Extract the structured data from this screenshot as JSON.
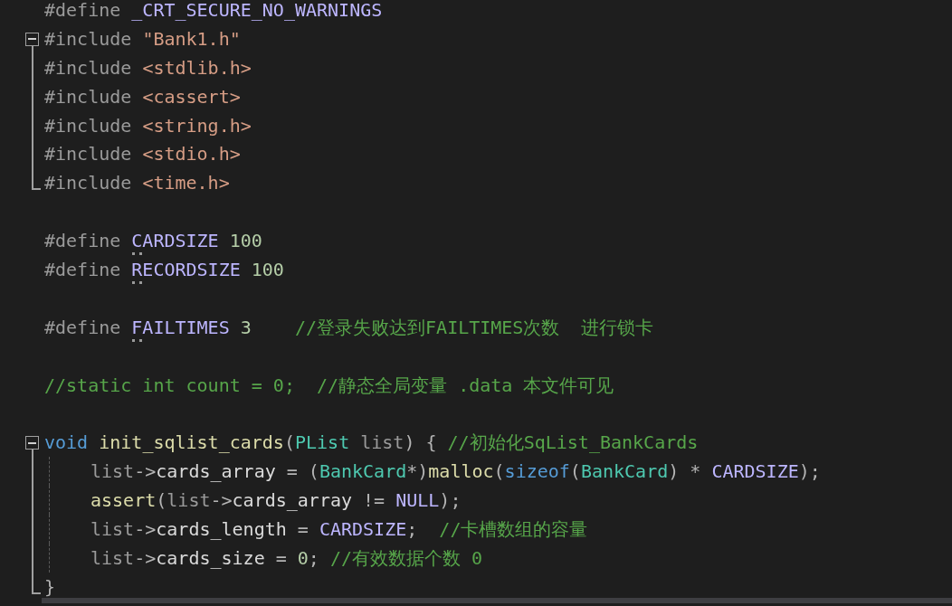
{
  "editor": {
    "lines": [
      {
        "kind": "code",
        "fold_box": false,
        "fold_line": false,
        "fold_end": false,
        "indented": false,
        "guide": false,
        "tokens": [
          {
            "text": "#define ",
            "kind": "preproc"
          },
          {
            "text": "_CRT_SECURE_NO_WARNINGS",
            "kind": "macro"
          }
        ]
      },
      {
        "kind": "code",
        "fold_box": true,
        "fold_line": false,
        "fold_end": false,
        "indented": false,
        "guide": false,
        "tokens": [
          {
            "text": "#include ",
            "kind": "preproc"
          },
          {
            "text": "\"Bank1.h\"",
            "kind": "string"
          }
        ]
      },
      {
        "kind": "code",
        "fold_box": false,
        "fold_line": true,
        "fold_end": false,
        "indented": false,
        "guide": false,
        "tokens": [
          {
            "text": "#include ",
            "kind": "preproc"
          },
          {
            "text": "<stdlib.h>",
            "kind": "string"
          }
        ]
      },
      {
        "kind": "code",
        "fold_box": false,
        "fold_line": true,
        "fold_end": false,
        "indented": false,
        "guide": false,
        "tokens": [
          {
            "text": "#include ",
            "kind": "preproc"
          },
          {
            "text": "<cassert>",
            "kind": "string"
          }
        ]
      },
      {
        "kind": "code",
        "fold_box": false,
        "fold_line": true,
        "fold_end": false,
        "indented": false,
        "guide": false,
        "tokens": [
          {
            "text": "#include ",
            "kind": "preproc"
          },
          {
            "text": "<string.h>",
            "kind": "string"
          }
        ]
      },
      {
        "kind": "code",
        "fold_box": false,
        "fold_line": true,
        "fold_end": false,
        "indented": false,
        "guide": false,
        "tokens": [
          {
            "text": "#include ",
            "kind": "preproc"
          },
          {
            "text": "<stdio.h>",
            "kind": "string"
          }
        ]
      },
      {
        "kind": "code",
        "fold_box": false,
        "fold_line": false,
        "fold_end": true,
        "indented": false,
        "guide": false,
        "tokens": [
          {
            "text": "#include ",
            "kind": "preproc"
          },
          {
            "text": "<time.h>",
            "kind": "string"
          }
        ]
      },
      {
        "kind": "blank"
      },
      {
        "kind": "code",
        "fold_box": false,
        "fold_line": false,
        "fold_end": false,
        "indented": false,
        "guide": false,
        "tokens": [
          {
            "text": "#define ",
            "kind": "preproc"
          },
          {
            "text": "CARDSIZE",
            "kind": "macro",
            "hint": true
          },
          {
            "text": " 100",
            "kind": "number"
          }
        ]
      },
      {
        "kind": "code",
        "fold_box": false,
        "fold_line": false,
        "fold_end": false,
        "indented": false,
        "guide": false,
        "tokens": [
          {
            "text": "#define ",
            "kind": "preproc"
          },
          {
            "text": "RECORDSIZE",
            "kind": "macro",
            "hint": true
          },
          {
            "text": " 100",
            "kind": "number"
          }
        ]
      },
      {
        "kind": "blank"
      },
      {
        "kind": "code",
        "fold_box": false,
        "fold_line": false,
        "fold_end": false,
        "indented": false,
        "guide": false,
        "tokens": [
          {
            "text": "#define ",
            "kind": "preproc"
          },
          {
            "text": "FAILTIMES",
            "kind": "macro",
            "hint": true
          },
          {
            "text": " 3",
            "kind": "number"
          },
          {
            "text": "    //登录失败达到FAILTIMES次数  进行锁卡",
            "kind": "comment"
          }
        ]
      },
      {
        "kind": "blank"
      },
      {
        "kind": "code",
        "fold_box": false,
        "fold_line": false,
        "fold_end": false,
        "indented": false,
        "guide": false,
        "tokens": [
          {
            "text": "//static int count = 0;  //静态全局变量 .data 本文件可见",
            "kind": "comment"
          }
        ]
      },
      {
        "kind": "blank"
      },
      {
        "kind": "code",
        "fold_box": true,
        "fold_line": false,
        "fold_end": false,
        "indented": false,
        "guide": false,
        "tokens": [
          {
            "text": "void",
            "kind": "keyword"
          },
          {
            "text": " init_sqlist_cards",
            "kind": "function"
          },
          {
            "text": "(",
            "kind": "punct"
          },
          {
            "text": "PList",
            "kind": "type"
          },
          {
            "text": " list",
            "kind": "param"
          },
          {
            "text": ") { ",
            "kind": "punct"
          },
          {
            "text": "//初始化SqList_BankCards",
            "kind": "comment"
          }
        ]
      },
      {
        "kind": "code",
        "fold_box": false,
        "fold_line": true,
        "fold_end": false,
        "indented": true,
        "guide": true,
        "tokens": [
          {
            "text": "list",
            "kind": "param"
          },
          {
            "text": "->",
            "kind": "punct"
          },
          {
            "text": "cards_array",
            "kind": "ident"
          },
          {
            "text": " = (",
            "kind": "punct"
          },
          {
            "text": "BankCard",
            "kind": "type"
          },
          {
            "text": "*)",
            "kind": "punct"
          },
          {
            "text": "malloc",
            "kind": "function"
          },
          {
            "text": "(",
            "kind": "punct"
          },
          {
            "text": "sizeof",
            "kind": "keyword"
          },
          {
            "text": "(",
            "kind": "punct"
          },
          {
            "text": "BankCard",
            "kind": "type"
          },
          {
            "text": ") * ",
            "kind": "punct"
          },
          {
            "text": "CARDSIZE",
            "kind": "macro"
          },
          {
            "text": ");",
            "kind": "punct"
          }
        ]
      },
      {
        "kind": "code",
        "fold_box": false,
        "fold_line": true,
        "fold_end": false,
        "indented": true,
        "guide": true,
        "tokens": [
          {
            "text": "assert",
            "kind": "function"
          },
          {
            "text": "(",
            "kind": "punct"
          },
          {
            "text": "list",
            "kind": "param"
          },
          {
            "text": "->",
            "kind": "punct"
          },
          {
            "text": "cards_array",
            "kind": "ident"
          },
          {
            "text": " != ",
            "kind": "punct"
          },
          {
            "text": "NULL",
            "kind": "macro"
          },
          {
            "text": ");",
            "kind": "punct"
          }
        ]
      },
      {
        "kind": "code",
        "fold_box": false,
        "fold_line": true,
        "fold_end": false,
        "indented": true,
        "guide": true,
        "tokens": [
          {
            "text": "list",
            "kind": "param"
          },
          {
            "text": "->",
            "kind": "punct"
          },
          {
            "text": "cards_length",
            "kind": "ident"
          },
          {
            "text": " = ",
            "kind": "punct"
          },
          {
            "text": "CARDSIZE",
            "kind": "macro"
          },
          {
            "text": ";  ",
            "kind": "punct"
          },
          {
            "text": "//卡槽数组的容量",
            "kind": "comment"
          }
        ]
      },
      {
        "kind": "code",
        "fold_box": false,
        "fold_line": true,
        "fold_end": false,
        "indented": true,
        "guide": true,
        "tokens": [
          {
            "text": "list",
            "kind": "param"
          },
          {
            "text": "->",
            "kind": "punct"
          },
          {
            "text": "cards_size",
            "kind": "ident"
          },
          {
            "text": " = ",
            "kind": "punct"
          },
          {
            "text": "0",
            "kind": "number"
          },
          {
            "text": "; ",
            "kind": "punct"
          },
          {
            "text": "//有效数据个数 0",
            "kind": "comment"
          }
        ]
      },
      {
        "kind": "code",
        "fold_box": false,
        "fold_line": false,
        "fold_end": true,
        "indented": false,
        "guide": false,
        "tokens": [
          {
            "text": "}",
            "kind": "punct"
          }
        ]
      }
    ]
  }
}
